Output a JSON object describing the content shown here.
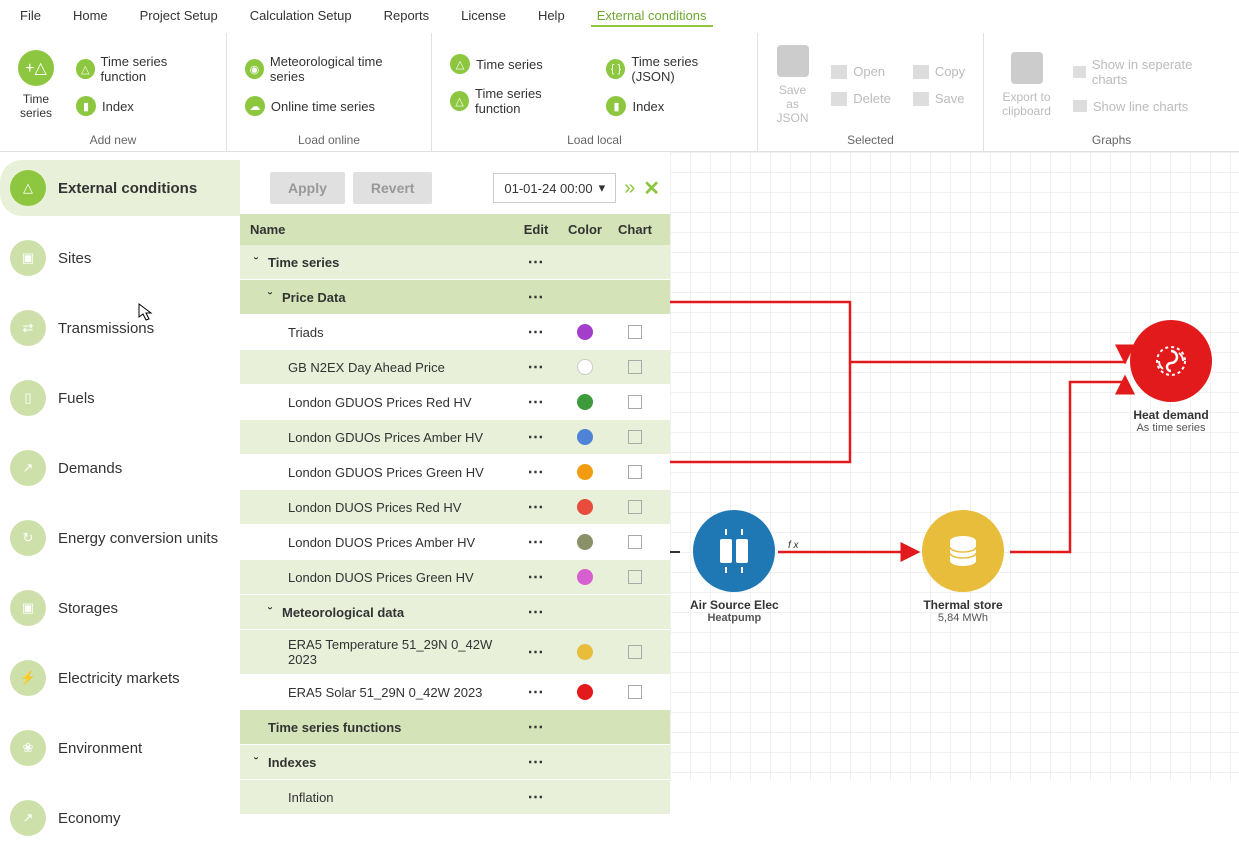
{
  "menu": [
    "File",
    "Home",
    "Project Setup",
    "Calculation Setup",
    "Reports",
    "License",
    "Help",
    "External conditions"
  ],
  "ribbon": {
    "add_new": {
      "label": "Add new",
      "time_series": "Time\nseries",
      "tsf": "Time series function",
      "index": "Index"
    },
    "load_online": {
      "label": "Load online",
      "met": "Meteorological time series",
      "online": "Online time series"
    },
    "load_local": {
      "label": "Load local",
      "ts": "Time series",
      "ts_json": "Time series (JSON)",
      "tsf": "Time series function",
      "index": "Index"
    },
    "selected": {
      "label": "Selected",
      "save_json": "Save as\nJSON",
      "open": "Open",
      "delete": "Delete",
      "copy": "Copy",
      "save": "Save"
    },
    "graphs": {
      "label": "Graphs",
      "export": "Export to\nclipboard",
      "sep": "Show in seperate charts",
      "line": "Show line charts"
    }
  },
  "sidebar": [
    "External conditions",
    "Sites",
    "Transmissions",
    "Fuels",
    "Demands",
    "Energy conversion units",
    "Storages",
    "Electricity markets",
    "Environment",
    "Economy"
  ],
  "mid": {
    "apply": "Apply",
    "revert": "Revert",
    "datetime": "01-01-24 00:00"
  },
  "headers": {
    "name": "Name",
    "edit": "Edit",
    "color": "Color",
    "chart": "Chart"
  },
  "groups": {
    "ts": "Time series",
    "price": "Price Data",
    "met": "Meteorological data",
    "tsf": "Time series functions",
    "idx": "Indexes"
  },
  "rows": {
    "price": [
      {
        "name": "Triads",
        "color": "#a23ec9"
      },
      {
        "name": "GB N2EX Day Ahead Price",
        "color": "#ffffff"
      },
      {
        "name": "London GDUOS Prices Red HV",
        "color": "#3d9a3d"
      },
      {
        "name": "London GDUOs Prices Amber HV",
        "color": "#4f83d6"
      },
      {
        "name": "London GDUOS Prices Green HV",
        "color": "#f39c12"
      },
      {
        "name": "London DUOS Prices Red HV",
        "color": "#e74c3c"
      },
      {
        "name": "London DUOS Prices Amber HV",
        "color": "#8a9068"
      },
      {
        "name": "London DUOS Prices Green HV",
        "color": "#d85fd0"
      }
    ],
    "met": [
      {
        "name": "ERA5 Temperature 51_29N 0_42W 2023",
        "color": "#e8bd3c"
      },
      {
        "name": "ERA5 Solar 51_29N 0_42W 2023",
        "color": "#e31a1c"
      }
    ],
    "idx": [
      {
        "name": "Inflation"
      }
    ]
  },
  "nodes": {
    "hp": {
      "label": "Air Source Elec",
      "sub": "Heatpump"
    },
    "store": {
      "label": "Thermal store",
      "sub": "5,84 MWh"
    },
    "demand": {
      "label": "Heat demand",
      "sub": "As time series"
    },
    "fx": "f x"
  }
}
